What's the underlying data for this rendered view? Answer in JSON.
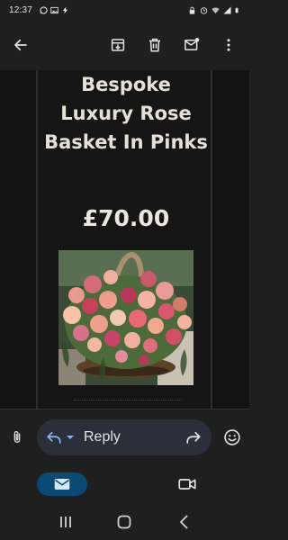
{
  "status_bar": {
    "time": "12:37",
    "left_icons": [
      "whatsapp-icon",
      "image-icon",
      "bolt-icon"
    ],
    "right_icons": [
      "lock-icon",
      "alarm-icon",
      "wifi-icon",
      "signal-icon",
      "battery-icon"
    ]
  },
  "toolbar": {
    "back_icon": "arrow-left-icon",
    "actions": [
      "archive-icon",
      "delete-icon",
      "mark-unread-icon",
      "more-vert-icon"
    ]
  },
  "email": {
    "product_title": "Bespoke Luxury Rose Basket In Pinks",
    "price": "£70.00",
    "image_alt_icon": "rose-basket-image"
  },
  "reply_bar": {
    "reply_label": "Reply",
    "attach_icon": "paperclip-icon",
    "reply_icon": "reply-icon",
    "dropdown_icon": "chevron-down-icon",
    "forward_icon": "forward-icon",
    "emoji_icon": "emoji-icon"
  },
  "bottom_nav": {
    "items": [
      "mail-icon",
      "video-icon"
    ],
    "active": "mail-icon"
  },
  "system_nav": {
    "items": [
      "recents-icon",
      "home-icon",
      "back-icon"
    ]
  },
  "colors": {
    "background": "#1f1f1f",
    "content_background": "#121212",
    "reply_pill": "#2a2f3a",
    "accent": "#0b4a74",
    "reply_icon": "#8ab4f8"
  }
}
